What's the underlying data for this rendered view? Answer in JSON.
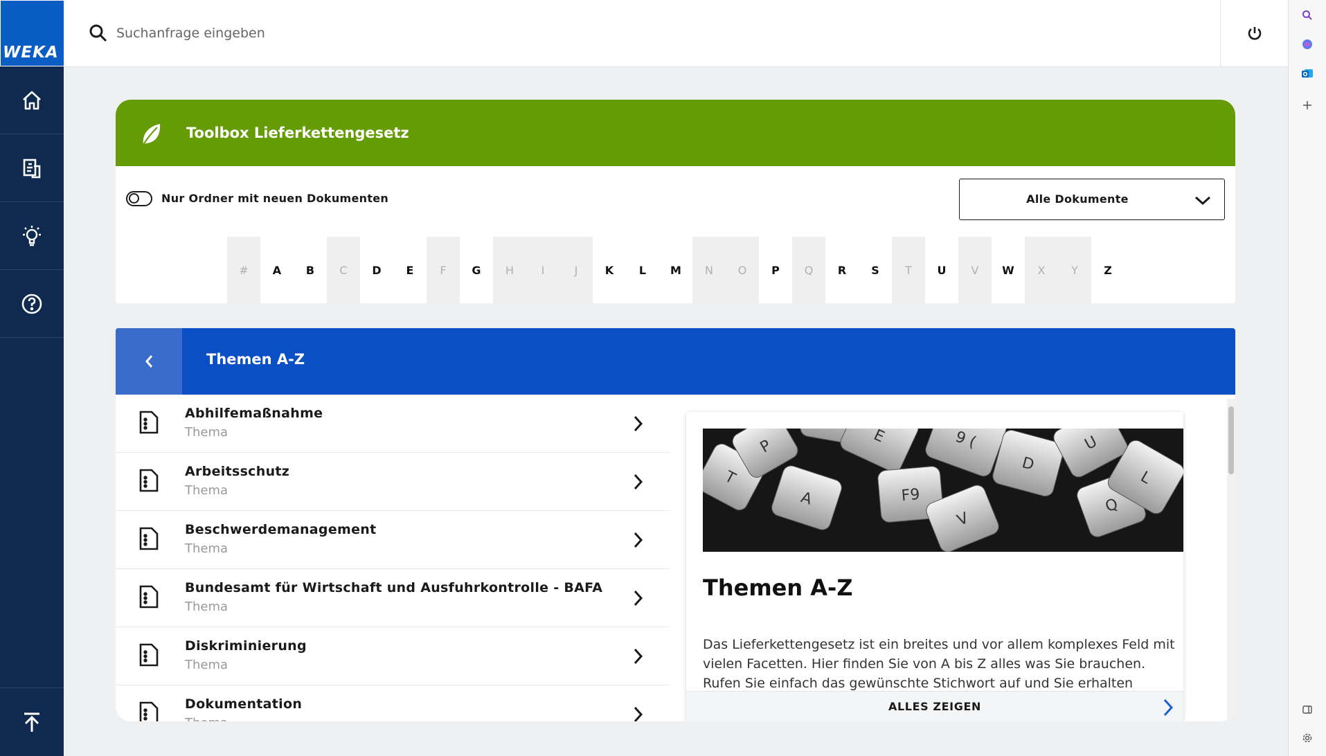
{
  "sidebar": {
    "logo_text": "WEKA",
    "items": [
      {
        "name": "home",
        "icon": "home-icon"
      },
      {
        "name": "documents",
        "icon": "document-list-icon"
      },
      {
        "name": "tips",
        "icon": "lightbulb-icon"
      },
      {
        "name": "help",
        "icon": "help-icon"
      }
    ],
    "bottom_icon": "scroll-top-icon"
  },
  "topbar": {
    "search_placeholder": "Suchanfrage eingeben",
    "power_icon": "power-icon"
  },
  "toolbox": {
    "title": "Toolbox Lieferkettengesetz",
    "icon": "leaf-icon",
    "toggle_label": "Nur Ordner mit neuen Dokumenten",
    "dropdown_value": "Alle Dokumente",
    "letters": [
      {
        "l": "#",
        "on": false
      },
      {
        "l": "A",
        "on": true
      },
      {
        "l": "B",
        "on": true
      },
      {
        "l": "C",
        "on": false
      },
      {
        "l": "D",
        "on": true
      },
      {
        "l": "E",
        "on": true
      },
      {
        "l": "F",
        "on": false
      },
      {
        "l": "G",
        "on": true
      },
      {
        "l": "H",
        "on": false
      },
      {
        "l": "I",
        "on": false
      },
      {
        "l": "J",
        "on": false
      },
      {
        "l": "K",
        "on": true
      },
      {
        "l": "L",
        "on": true
      },
      {
        "l": "M",
        "on": true
      },
      {
        "l": "N",
        "on": false
      },
      {
        "l": "O",
        "on": false
      },
      {
        "l": "P",
        "on": true
      },
      {
        "l": "Q",
        "on": false
      },
      {
        "l": "R",
        "on": true
      },
      {
        "l": "S",
        "on": true
      },
      {
        "l": "T",
        "on": false
      },
      {
        "l": "U",
        "on": true
      },
      {
        "l": "V",
        "on": false
      },
      {
        "l": "W",
        "on": true
      },
      {
        "l": "X",
        "on": false
      },
      {
        "l": "Y",
        "on": false
      },
      {
        "l": "Z",
        "on": true
      }
    ]
  },
  "themen": {
    "title": "Themen A-Z",
    "items": [
      {
        "title": "Abhilfemaßnahme",
        "type": "Thema"
      },
      {
        "title": "Arbeitsschutz",
        "type": "Thema"
      },
      {
        "title": "Beschwerdemanagement",
        "type": "Thema"
      },
      {
        "title": "Bundesamt für Wirtschaft und Ausfuhrkontrolle - BAFA",
        "type": "Thema"
      },
      {
        "title": "Diskriminierung",
        "type": "Thema"
      },
      {
        "title": "Dokumentation",
        "type": "Thema"
      }
    ],
    "preview": {
      "title": "Themen A-Z",
      "text": "Das Lieferkettengesetz ist ein breites und vor allem komplexes Feld mit vielen Facetten. Hier finden Sie von A bis Z alles was Sie brauchen. Rufen Sie einfach das gewünschte Stichwort auf und Sie erhalten automatisch",
      "show_all": "ALLES ZEIGEN",
      "image_keys": [
        "T",
        "P",
        "A",
        "Win",
        "E",
        "F9",
        "9 (",
        "V",
        "D",
        "U",
        "Q",
        "L"
      ]
    }
  },
  "colors": {
    "sidebar": "#0f2a4e",
    "logo": "#0a5dc2",
    "toolbox_header": "#659c05",
    "themen_header": "#0a4fc4",
    "accent_chevron": "#1a5fd0"
  }
}
